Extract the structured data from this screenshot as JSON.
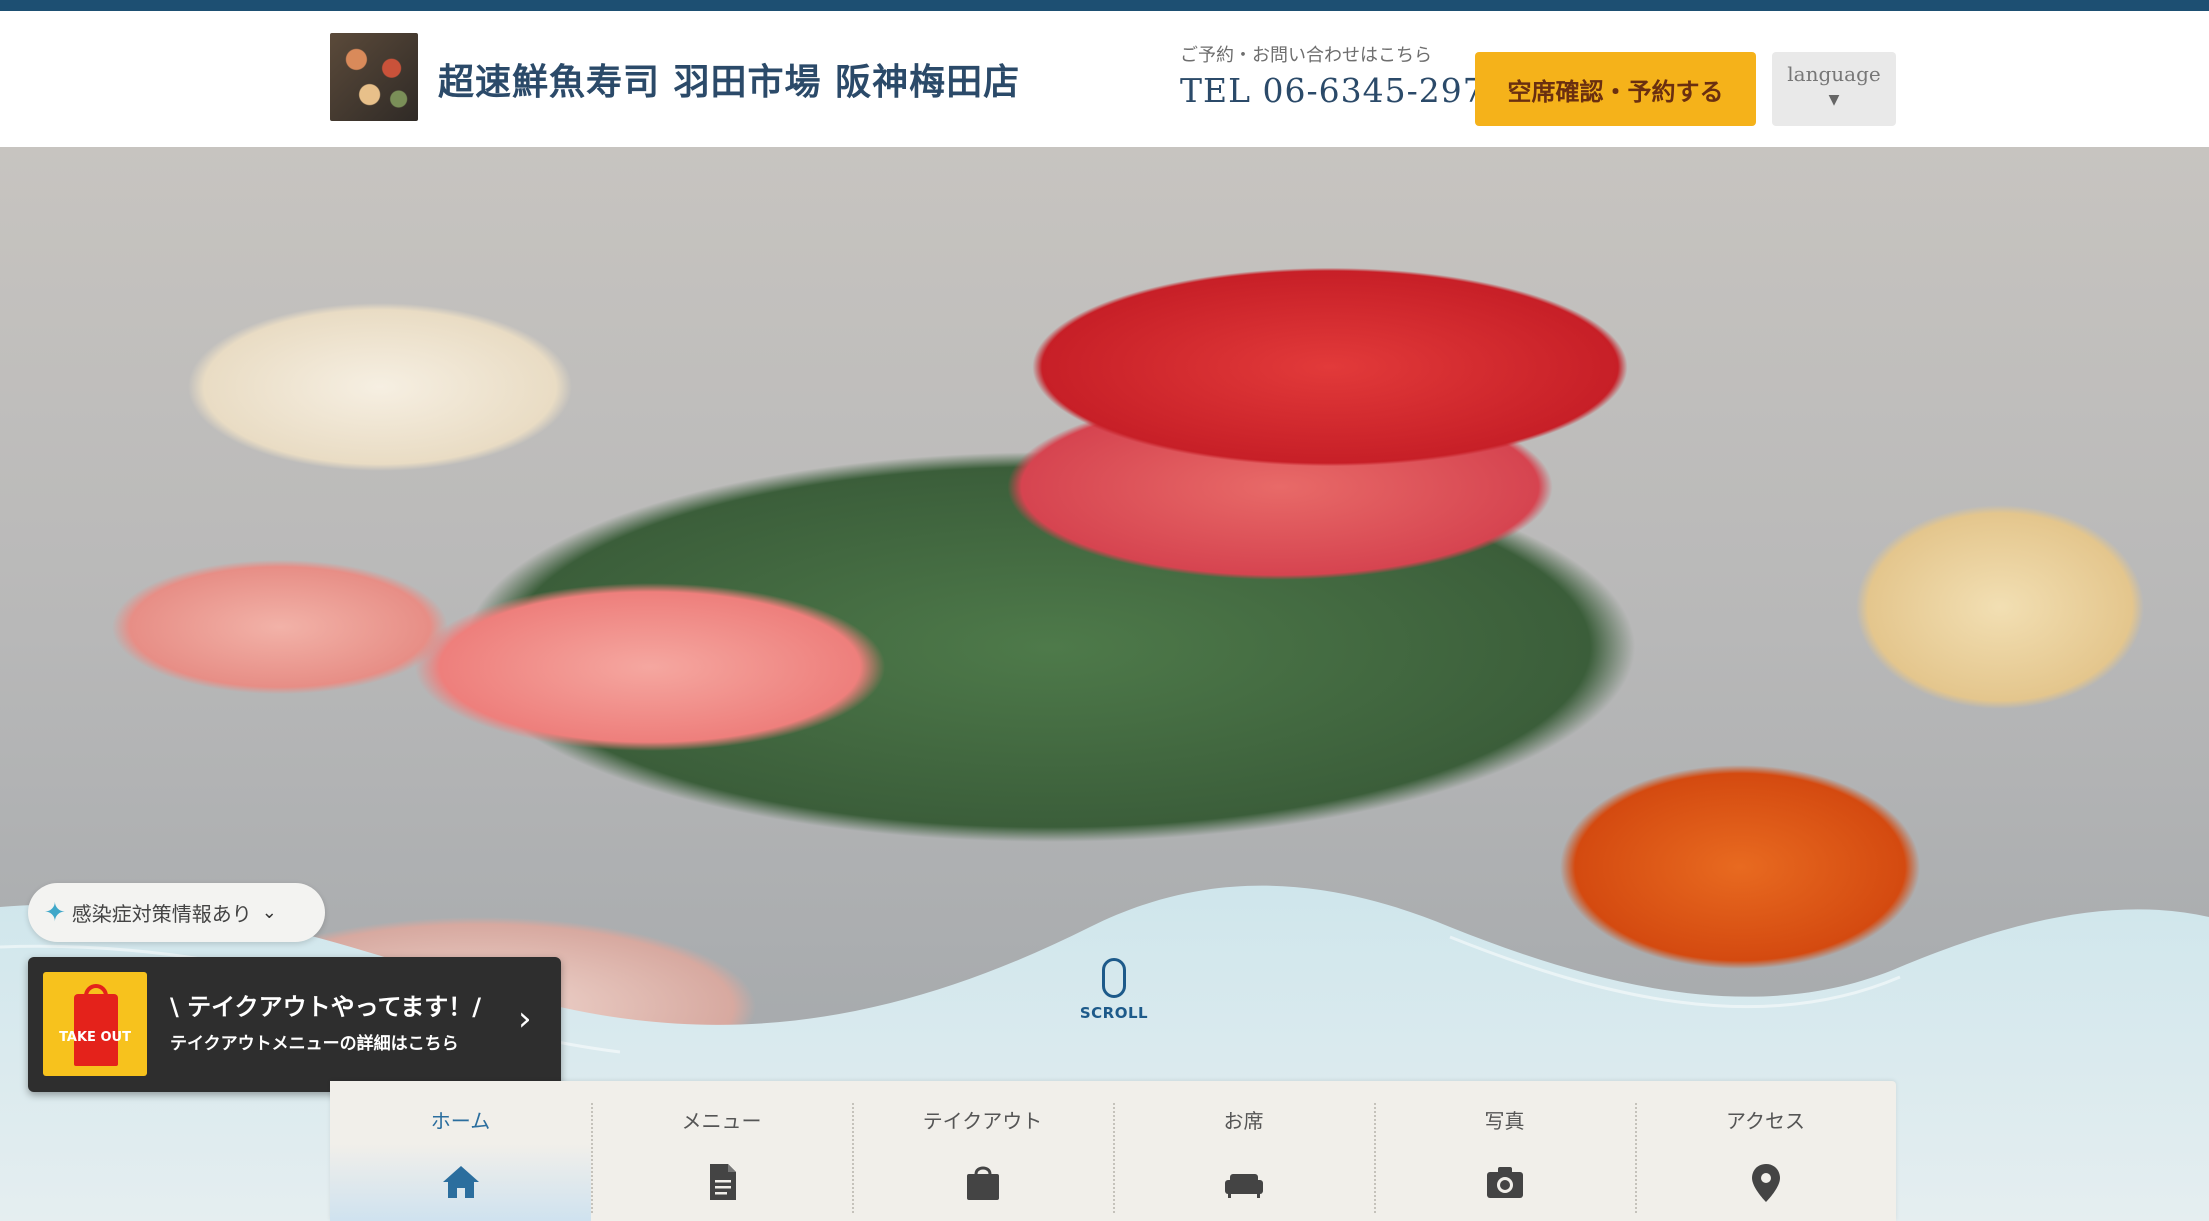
{
  "header": {
    "shop_name": "超速鮮魚寿司 羽田市場 阪神梅田店",
    "contact_label": "ご予約・お問い合わせはこちら",
    "tel": "TEL 06-6345-2976",
    "reserve_label": "空席確認・予約する",
    "language_label": "language",
    "language_caret": "▼"
  },
  "covid": {
    "label": "感染症対策情報あり",
    "icon": "sparkle-icon",
    "chevron": "chevron-down-icon"
  },
  "takeout": {
    "icon_text": "TAKE OUT",
    "title": "\\ テイクアウトやってます！/",
    "subtitle": "テイクアウトメニューの詳細はこちら",
    "arrow": "›"
  },
  "scroll": {
    "label": "SCROLL"
  },
  "nav": {
    "items": [
      {
        "label": "ホーム",
        "icon": "home-icon"
      },
      {
        "label": "メニュー",
        "icon": "document-icon"
      },
      {
        "label": "テイクアウト",
        "icon": "shopping-bag-icon"
      },
      {
        "label": "お席",
        "icon": "sofa-icon"
      },
      {
        "label": "写真",
        "icon": "camera-icon"
      },
      {
        "label": "アクセス",
        "icon": "map-pin-icon"
      }
    ],
    "active_index": 0
  },
  "colors": {
    "brand_navy": "#2b4a69",
    "accent_yellow": "#f5b21a",
    "nav_active": "#2b6e9e",
    "top_stripe": "#1d4f72"
  }
}
